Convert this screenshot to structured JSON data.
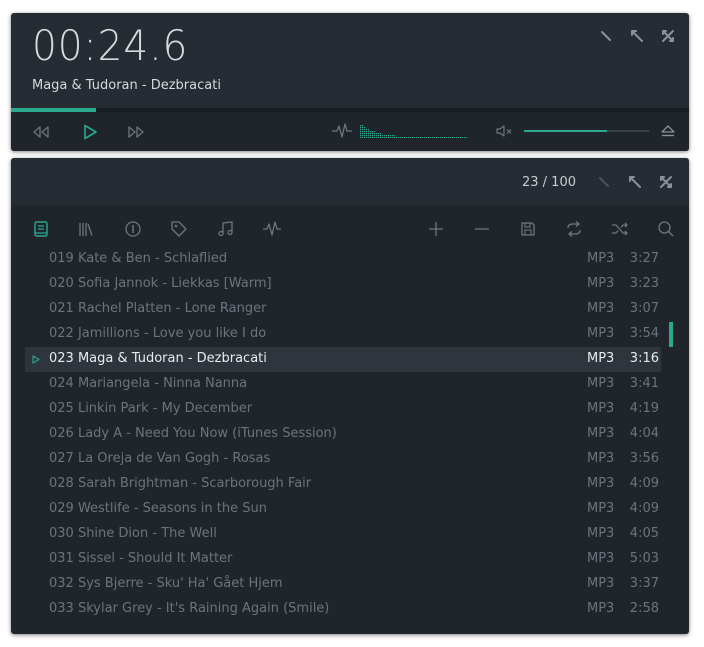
{
  "player": {
    "time": "00:24.6",
    "track_title": "Maga & Tudoran - Dezbracati",
    "progress": 0.125,
    "volume": 0.66,
    "icons": {
      "rewind": "rewind-icon",
      "play": "play-icon",
      "fast_forward": "fast-forward-icon",
      "equalizer": "waveform-icon",
      "visualizer": "spectrum-visualizer-icon",
      "mute": "mute-icon",
      "eject": "eject-icon",
      "minimize": "minimize-icon",
      "restore": "restore-icon",
      "maximize": "maximize-icon"
    }
  },
  "playlist": {
    "count": "23 / 100",
    "toolbar_icons": [
      "book-icon",
      "library-icon",
      "info-icon",
      "tag-icon",
      "music-note-icon",
      "waveform-icon",
      "add-icon",
      "remove-icon",
      "save-icon",
      "repeat-icon",
      "shuffle-icon",
      "search-icon"
    ],
    "tracks": [
      {
        "name": "019 Kate & Ben - Schlaflied",
        "format": "MP3",
        "duration": "3:27"
      },
      {
        "name": "020 Sofia Jannok - Liekkas [Warm]",
        "format": "MP3",
        "duration": "3:23"
      },
      {
        "name": "021 Rachel Platten - Lone Ranger",
        "format": "MP3",
        "duration": "3:07"
      },
      {
        "name": "022 Jamillions - Love you like I do",
        "format": "MP3",
        "duration": "3:54"
      },
      {
        "name": "023 Maga & Tudoran - Dezbracati",
        "format": "MP3",
        "duration": "3:16",
        "active": true
      },
      {
        "name": "024 Mariangela - Ninna Nanna",
        "format": "MP3",
        "duration": "3:41"
      },
      {
        "name": "025 Linkin Park - My December",
        "format": "MP3",
        "duration": "4:19"
      },
      {
        "name": "026 Lady A - Need You Now (iTunes Session)",
        "format": "MP3",
        "duration": "4:04"
      },
      {
        "name": "027 La Oreja de Van Gogh - Rosas",
        "format": "MP3",
        "duration": "3:56"
      },
      {
        "name": "028 Sarah Brightman - Scarborough Fair",
        "format": "MP3",
        "duration": "4:09"
      },
      {
        "name": "029 Westlife - Seasons in the Sun",
        "format": "MP3",
        "duration": "4:09"
      },
      {
        "name": "030 Shine Dion - The Well",
        "format": "MP3",
        "duration": "4:05"
      },
      {
        "name": "031 Sissel - Should It Matter",
        "format": "MP3",
        "duration": "5:03"
      },
      {
        "name": "032 Sys Bjerre - Sku' Ha' Gået Hjem",
        "format": "MP3",
        "duration": "3:37"
      },
      {
        "name": "033 Skylar Grey - It's Raining Again (Smile)",
        "format": "MP3",
        "duration": "2:58"
      }
    ]
  },
  "colors": {
    "accent": "#2aa98e",
    "panel": "#262c33",
    "panel_dark": "#20252b",
    "text": "#d7dadd",
    "text_dim": "#6b747c"
  }
}
